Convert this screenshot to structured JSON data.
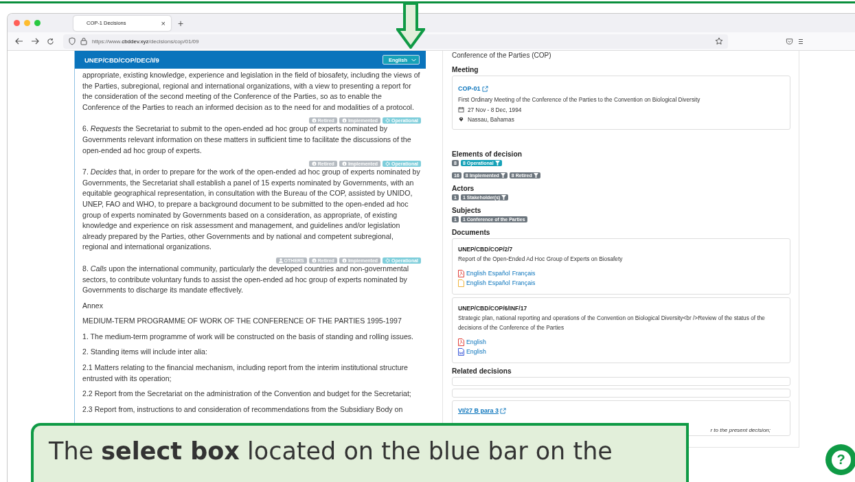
{
  "browser": {
    "tab": {
      "title": "COP-1 Decisions",
      "close": "×"
    },
    "new_tab": "+",
    "url": "https://www.**cbddev.xyz**/decisions/cop/01/09"
  },
  "decision": {
    "title": "UNEP/CBD/COP/DEC/I/9",
    "language_select": "English",
    "paragraphs": [
      {
        "text": "appropriate, existing knowledge, experience and legislation in the field of biosafety, including the views of the Parties, subregional, regional and international organizations, with a view to presenting a report for the consideration of the second meeting of the Conference of the Parties, so as to enable the Conference of the Parties to reach an informed decision as to the need for and modalities of a protocol."
      },
      {
        "text": "6. *Requests* the Secretariat to submit to the open-ended ad hoc group of experts nominated by Governments relevant information on these matters in sufficient time to facilitate the discussions of the open-ended ad hoc group of experts.",
        "tags": [
          {
            "label": "Retired",
            "kind": "retired"
          },
          {
            "label": "Implemented",
            "kind": "implemented"
          },
          {
            "label": "Operational",
            "kind": "operational"
          }
        ]
      },
      {
        "text": "7. *Decides* that, in order to prepare for the work of the open-ended ad hoc group of experts nominated by Governments, the Secretariat shall establish a panel of 15 experts nominated by Governments, with an equitable geographical representation, in consultation with the Bureau of the COP, assisted by UNIDO, UNEP, FAO and WHO, to prepare a background document to be submitted to the open-ended ad hoc group of experts nominated by Governments based on a consideration, as appropriate, of existing knowledge and experience on risk assessment and management, and guidelines and/or legislation already prepared by the Parties, other Governments and by national and competent subregional, regional and international organizations.",
        "tags": [
          {
            "label": "Retired",
            "kind": "retired"
          },
          {
            "label": "Implemented",
            "kind": "implemented"
          },
          {
            "label": "Operational",
            "kind": "operational"
          }
        ]
      },
      {
        "text": "8. *Calls* upon the international community, particularly the developed countries and non-governmental sectors, to contribute voluntary funds to assist the open-ended ad hoc group of experts nominated by Governments to discharge its mandate effectively.",
        "tags": [
          {
            "label": "OTHERS",
            "kind": "actor"
          },
          {
            "label": "Retired",
            "kind": "retired"
          },
          {
            "label": "Implemented",
            "kind": "implemented"
          },
          {
            "label": "Operational",
            "kind": "operational"
          }
        ]
      },
      {
        "text": "Annex"
      },
      {
        "text": "MEDIUM-TERM PROGRAMME OF WORK OF THE CONFERENCE OF THE PARTIES 1995-1997"
      },
      {
        "text": "1. The medium-term programme of work will be constructed on the basis of standing and rolling issues."
      },
      {
        "text": "2. Standing items will include inter alia:"
      },
      {
        "text": "2.1 Matters relating to the financial mechanism, including report from the interim institutional structure entrusted with its operation;"
      },
      {
        "text": "2.2 Report from the Secretariat on the administration of the Convention and budget for the Secretariat;"
      },
      {
        "text": "2.3 Report from, instructions to and consideration of recommendations from the Subsidiary Body on"
      }
    ]
  },
  "details": {
    "body": "Conference of the Parties (COP)",
    "meeting": {
      "heading": "Meeting",
      "code": "COP-01",
      "name": "First Ordinary Meeting of the Conference of the Parties to the Convention on Biological Diversity",
      "dates": "27 Nov - 8 Dec, 1994",
      "place": "Nassau, Bahamas"
    },
    "sections": [
      {
        "heading": "Elements of decision",
        "rows": [
          {
            "count": "8",
            "badges": [
              {
                "label": "8 Operational",
                "kind": "operational",
                "filter": true
              }
            ]
          },
          {
            "count": "16",
            "badges": [
              {
                "label": "8 Implemented",
                "kind": "plain",
                "filter": true
              },
              {
                "label": "8 Retired",
                "kind": "plain",
                "filter": true
              }
            ]
          }
        ]
      },
      {
        "heading": "Actors",
        "rows": [
          {
            "count": "1",
            "badges": [
              {
                "label": "1 Stakeholder(s)",
                "kind": "plain",
                "filter": true
              }
            ]
          }
        ]
      },
      {
        "heading": "Subjects",
        "rows": [
          {
            "count": "1",
            "badges": [
              {
                "label": "1 Conference of the Parties",
                "kind": "plain",
                "filter": false
              }
            ]
          }
        ]
      }
    ],
    "documents_heading": "Documents",
    "documents": [
      {
        "symbol": "UNEP/CBD/COP/2/7",
        "title": "Report of the Open-Ended Ad Hoc Group of Experts on Biosafety",
        "files": [
          {
            "kind": "pdf",
            "languages": [
              "English",
              "Español",
              "Français"
            ]
          },
          {
            "kind": "file",
            "languages": [
              "English",
              "Español",
              "Français"
            ]
          }
        ]
      },
      {
        "symbol": "UNEP/CBD/COP/6/INF/17",
        "title": "Strategic plan, national reporting and operations of the Convention on Biological Diversity<br />Review of the status of the decisions of the Conference of the Parties",
        "files": [
          {
            "kind": "pdf",
            "languages": [
              "English"
            ]
          },
          {
            "kind": "word",
            "languages": [
              "English"
            ]
          }
        ]
      }
    ],
    "related_heading": "Related decisions",
    "related": [
      {
        "kind": "blank"
      },
      {
        "kind": "blank"
      },
      {
        "kind": "link",
        "link": "VI/27 B para 3",
        "note": "r to the present decision;"
      }
    ]
  },
  "help_button": "?",
  "callout": {
    "text": "The **select box** located on the blue bar on the"
  }
}
